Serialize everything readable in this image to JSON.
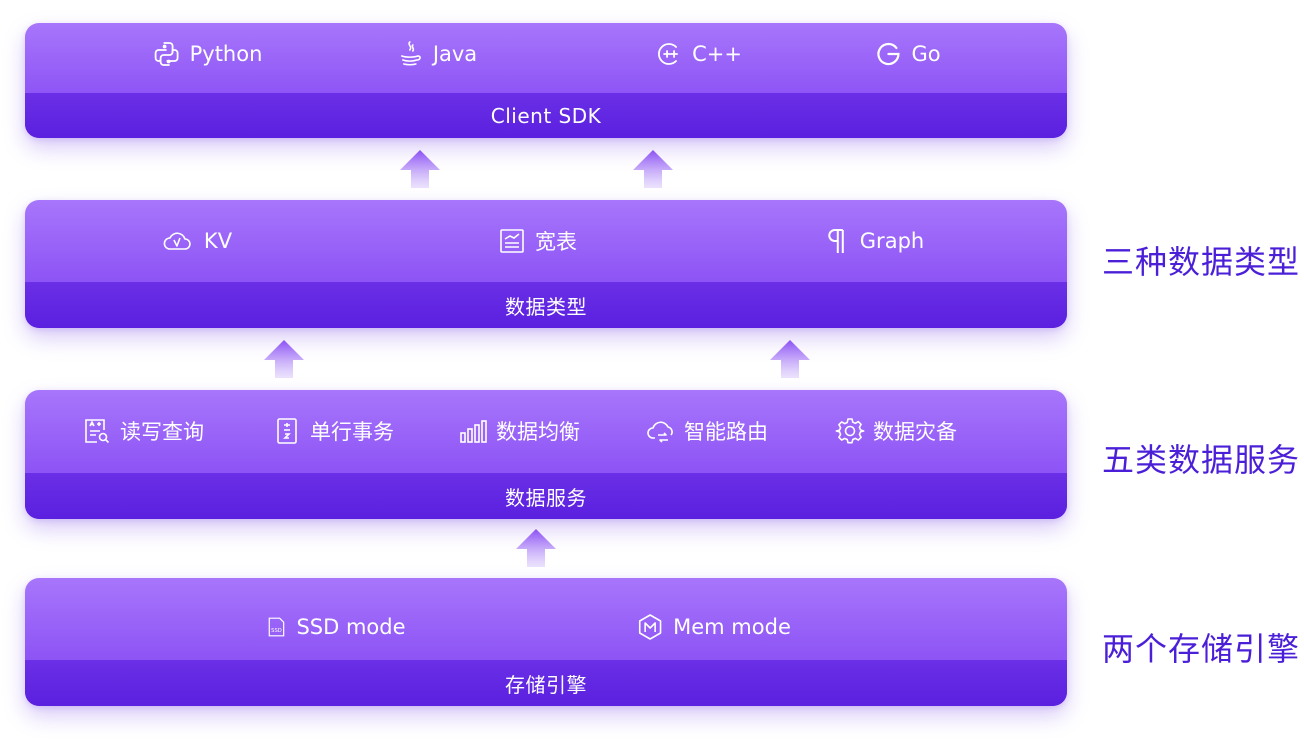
{
  "layers": {
    "sdk": {
      "items": [
        {
          "label": "Python",
          "icon": "python-icon"
        },
        {
          "label": "Java",
          "icon": "java-icon"
        },
        {
          "label": "C++",
          "icon": "cpp-icon"
        },
        {
          "label": "Go",
          "icon": "go-icon"
        }
      ],
      "bar_label": "Client SDK"
    },
    "types": {
      "items": [
        {
          "label": "KV",
          "icon": "cloud-icon"
        },
        {
          "label": "宽表",
          "icon": "table-chart-icon"
        },
        {
          "label": "Graph",
          "icon": "pilcrow-icon"
        }
      ],
      "bar_label": "数据类型"
    },
    "services": {
      "items": [
        {
          "label": "读写查询",
          "icon": "search-doc-icon"
        },
        {
          "label": "单行事务",
          "icon": "transaction-doc-icon"
        },
        {
          "label": "数据均衡",
          "icon": "bar-chart-icon"
        },
        {
          "label": "智能路由",
          "icon": "cloud-route-icon"
        },
        {
          "label": "数据灾备",
          "icon": "gear-icon"
        }
      ],
      "bar_label": "数据服务"
    },
    "engines": {
      "items": [
        {
          "label": "SSD mode",
          "icon": "ssd-icon"
        },
        {
          "label": "Mem mode",
          "icon": "memory-hex-icon"
        }
      ],
      "bar_label": "存储引擎"
    }
  },
  "side_labels": {
    "types": "三种数据类型",
    "services": "五类数据服务",
    "engines": "两个存储引擎"
  },
  "colors": {
    "accent": "#8f56f5",
    "bar": "#5b20df",
    "side_text": "#4b1fd8"
  }
}
